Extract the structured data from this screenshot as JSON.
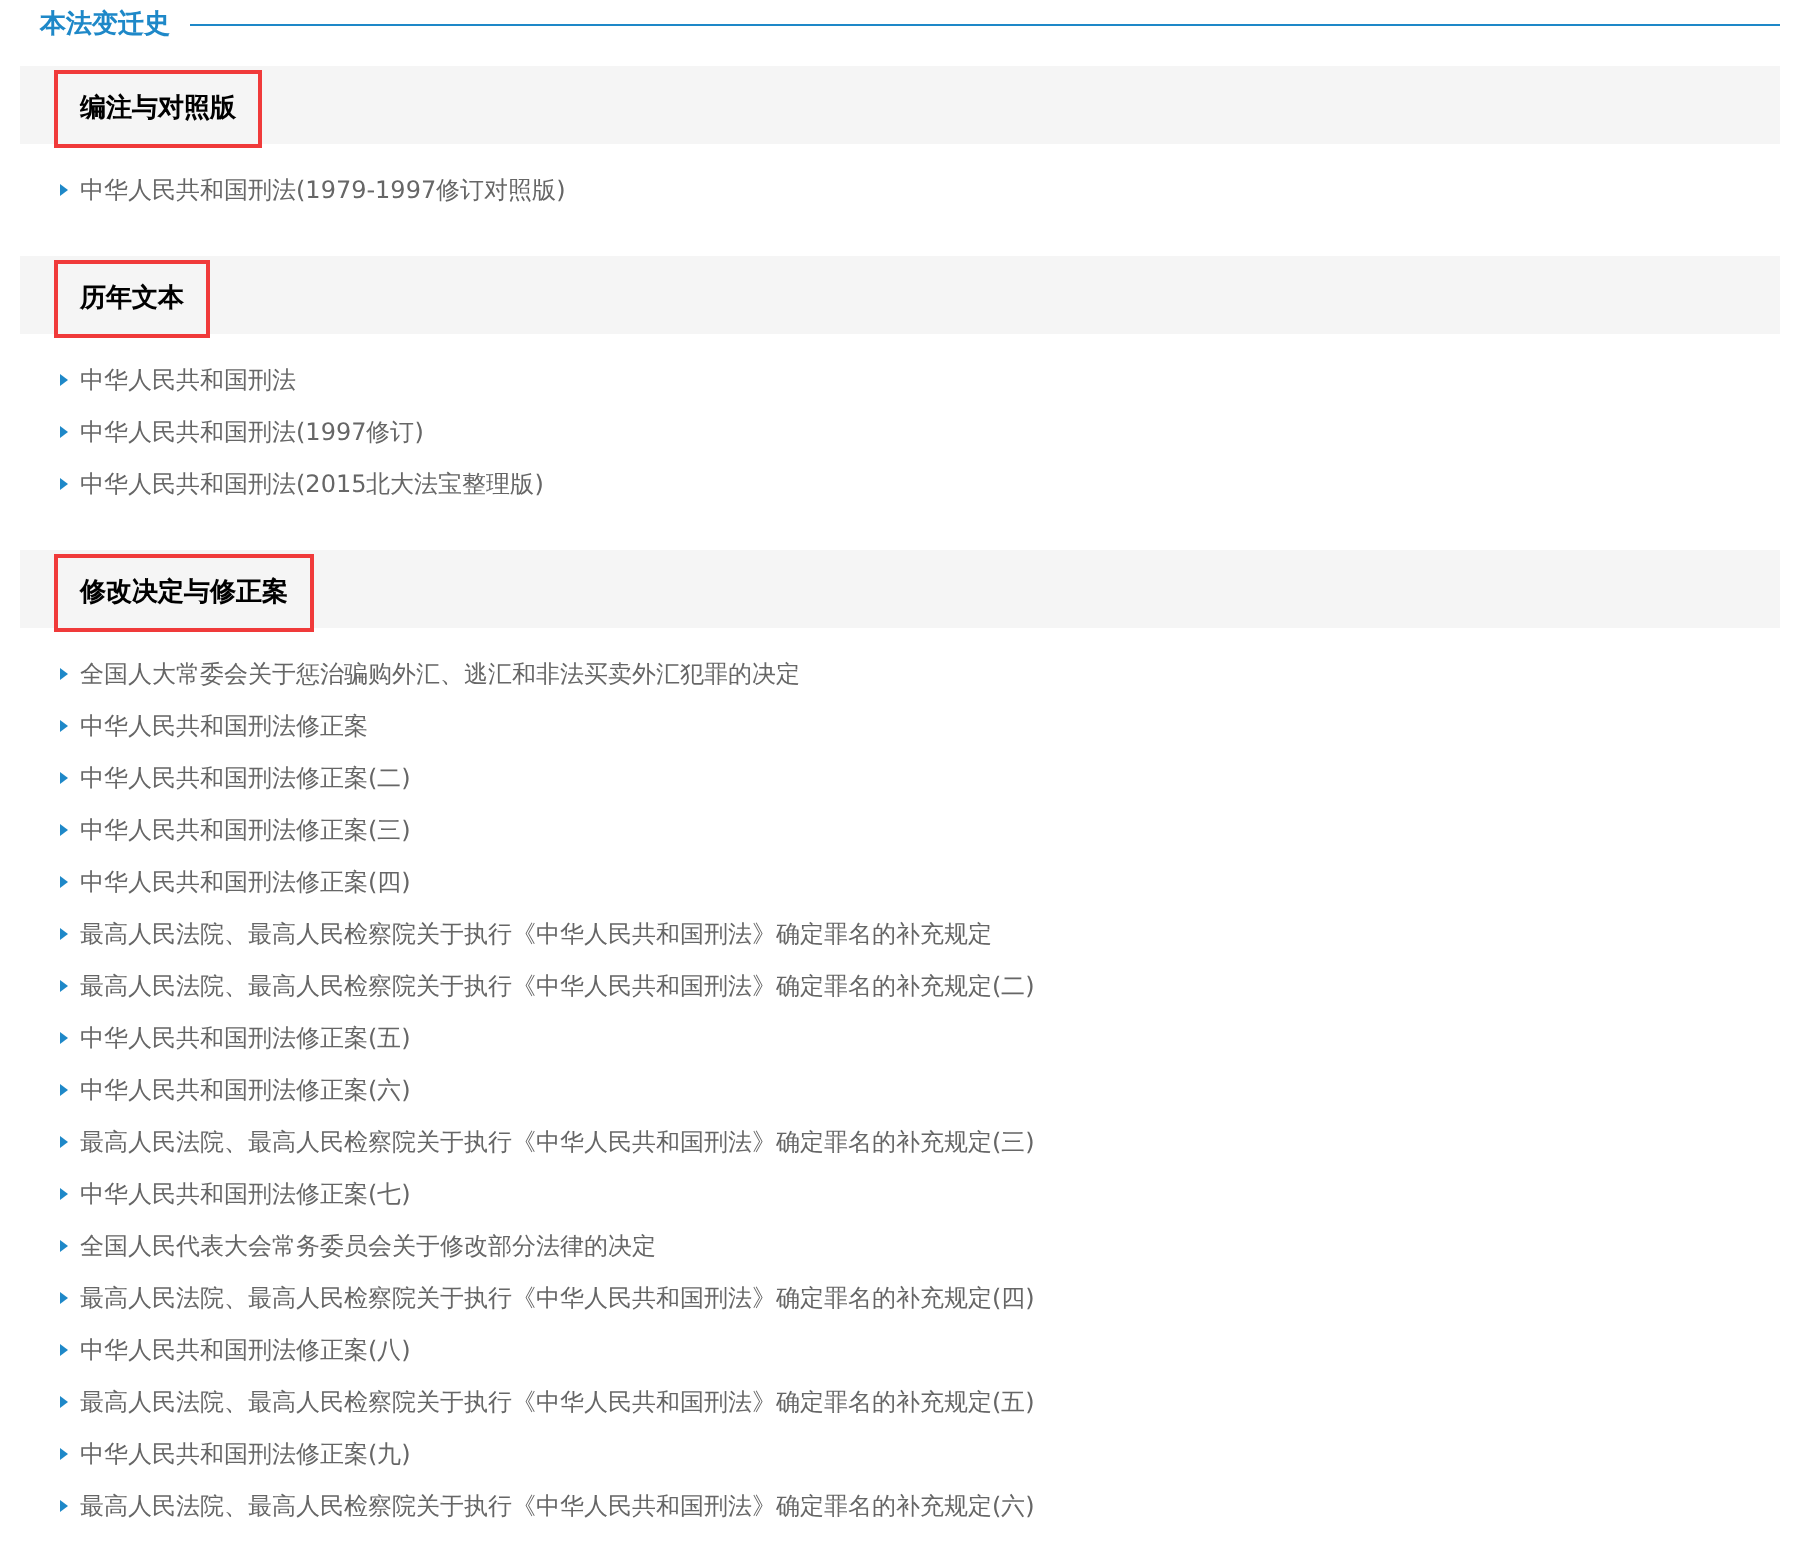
{
  "title": "本法变迁史",
  "sections": [
    {
      "heading": "编注与对照版",
      "highlighted": true,
      "items": [
        "中华人民共和国刑法(1979-1997修订对照版)"
      ]
    },
    {
      "heading": "历年文本",
      "highlighted": true,
      "items": [
        "中华人民共和国刑法",
        "中华人民共和国刑法(1997修订)",
        "中华人民共和国刑法(2015北大法宝整理版)"
      ]
    },
    {
      "heading": "修改决定与修正案",
      "highlighted": true,
      "items": [
        "全国人大常委会关于惩治骗购外汇、逃汇和非法买卖外汇犯罪的决定",
        "中华人民共和国刑法修正案",
        "中华人民共和国刑法修正案(二)",
        "中华人民共和国刑法修正案(三)",
        "中华人民共和国刑法修正案(四)",
        "最高人民法院、最高人民检察院关于执行《中华人民共和国刑法》确定罪名的补充规定",
        "最高人民法院、最高人民检察院关于执行《中华人民共和国刑法》确定罪名的补充规定(二)",
        "中华人民共和国刑法修正案(五)",
        "中华人民共和国刑法修正案(六)",
        "最高人民法院、最高人民检察院关于执行《中华人民共和国刑法》确定罪名的补充规定(三)",
        "中华人民共和国刑法修正案(七)",
        "全国人民代表大会常务委员会关于修改部分法律的决定",
        "最高人民法院、最高人民检察院关于执行《中华人民共和国刑法》确定罪名的补充规定(四)",
        "中华人民共和国刑法修正案(八)",
        "最高人民法院、最高人民检察院关于执行《中华人民共和国刑法》确定罪名的补充规定(五)",
        "中华人民共和国刑法修正案(九)",
        "最高人民法院、最高人民检察院关于执行《中华人民共和国刑法》确定罪名的补充规定(六)"
      ]
    }
  ]
}
